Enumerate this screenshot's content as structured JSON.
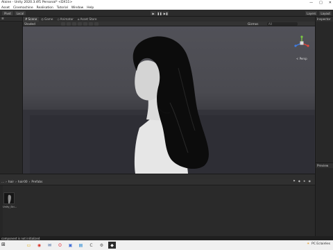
{
  "window": {
    "title": "Alaine - Unity 2020.3.4f1 Personal* <DX11>",
    "controls": [
      "—",
      "□",
      "✕"
    ]
  },
  "menu": [
    "Asset",
    "Cinemachine",
    "Realisation",
    "Tutorial",
    "Window",
    "Help"
  ],
  "toolbar": {
    "left_buttons": [
      "Pivot",
      "Local"
    ],
    "play": [
      "▶",
      "❚❚",
      "▶❚"
    ],
    "right": [
      "Layers",
      "Layout"
    ]
  },
  "scene_tabs": [
    "Scene",
    "Game",
    "Animator",
    "Asset Store"
  ],
  "scene_toolbar": {
    "shading": "Shaded",
    "gizmos": "Gizmos",
    "search_placeholder": "All"
  },
  "viewport": {
    "persp_label": "< Persp"
  },
  "inspector": {
    "title": "Inspector"
  },
  "preview": {
    "title": "Preview"
  },
  "project": {
    "breadcrumb": [
      "...",
      "hair",
      "hair00",
      "Prefabs"
    ],
    "assets": [
      {
        "name": "Unity_Ski..."
      }
    ]
  },
  "status": "component is not initialized",
  "taskbar": {
    "clock": "PC  Eclairées"
  },
  "colors": {
    "accent": "#4a90d9",
    "panel": "#282828"
  }
}
